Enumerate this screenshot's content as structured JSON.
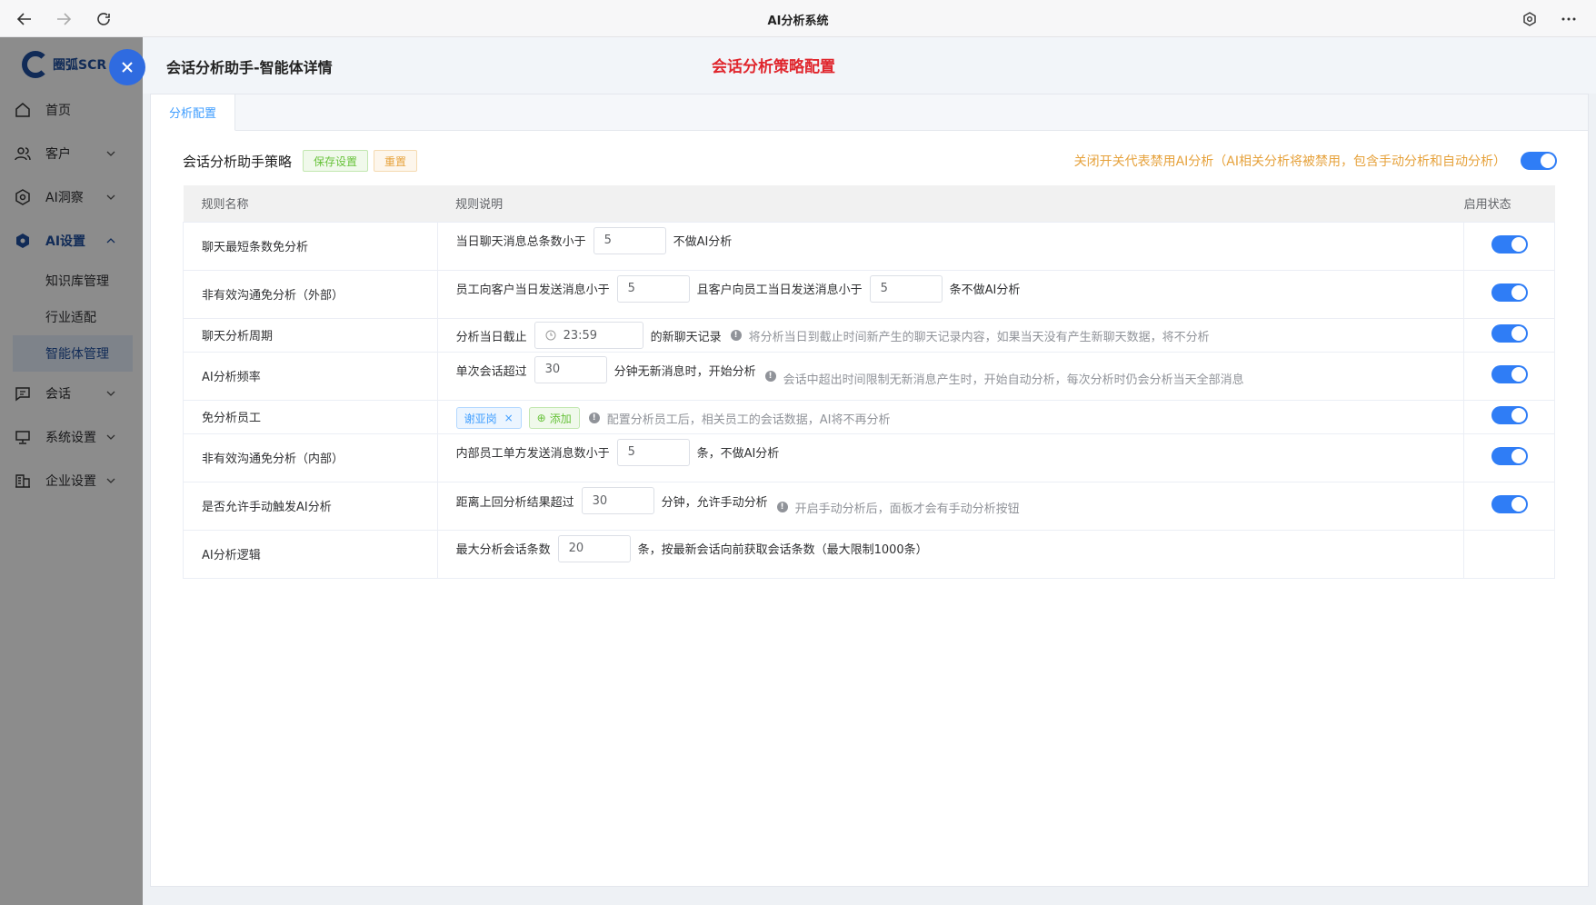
{
  "browser": {
    "title": "AI分析系统"
  },
  "sidebar": {
    "logo_text": "圈弧SCR",
    "items": [
      {
        "label": "首页"
      },
      {
        "label": "客户"
      },
      {
        "label": "AI洞察"
      },
      {
        "label": "AI设置"
      },
      {
        "label": "会话"
      },
      {
        "label": "系统设置"
      },
      {
        "label": "企业设置"
      }
    ],
    "sub_items": [
      {
        "label": "知识库管理"
      },
      {
        "label": "行业适配"
      },
      {
        "label": "智能体管理"
      }
    ]
  },
  "drawer": {
    "title": "会话分析助手-智能体详情",
    "annotation": "会话分析策略配置",
    "tab": "分析配置",
    "strategy_title": "会话分析助手策略",
    "save_label": "保存设置",
    "reset_label": "重置",
    "master_hint": "关闭开关代表禁用AI分析（AI相关分析将被禁用，包含手动分析和自动分析）",
    "master_enabled": true
  },
  "table": {
    "headers": {
      "name": "规则名称",
      "desc": "规则说明",
      "state": "启用状态"
    },
    "rows": [
      {
        "name": "聊天最短条数免分析",
        "t1": "当日聊天消息总条数小于",
        "v1": "5",
        "t2": "不做AI分析",
        "enabled": true
      },
      {
        "name": "非有效沟通免分析（外部）",
        "t1": "员工向客户当日发送消息小于",
        "v1": "5",
        "t2": "且客户向员工当日发送消息小于",
        "v2": "5",
        "t3": "条不做AI分析",
        "enabled": true
      },
      {
        "name": "聊天分析周期",
        "t1": "分析当日截止",
        "v1": "23:59",
        "t2": "的新聊天记录",
        "hint": "将分析当日到截止时间新产生的聊天记录内容，如果当天没有产生新聊天数据，将不分析",
        "enabled": true
      },
      {
        "name": "AI分析频率",
        "t1": "单次会话超过",
        "v1": "30",
        "t2": "分钟无新消息时，开始分析",
        "hint": "会话中超出时间限制无新消息产生时，开始自动分析，每次分析时仍会分析当天全部消息",
        "enabled": true
      },
      {
        "name": "免分析员工",
        "tag": "谢亚岗",
        "add": "添加",
        "hint": "配置分析员工后，相关员工的会话数据，AI将不再分析",
        "enabled": true
      },
      {
        "name": "非有效沟通免分析（内部）",
        "t1": "内部员工单方发送消息数小于",
        "v1": "5",
        "t2": "条，不做AI分析",
        "enabled": true
      },
      {
        "name": "是否允许手动触发AI分析",
        "t1": "距离上回分析结果超过",
        "v1": "30",
        "t2": "分钟，允许手动分析",
        "hint": "开启手动分析后，面板才会有手动分析按钮",
        "enabled": true
      },
      {
        "name": "AI分析逻辑",
        "t1": "最大分析会话条数",
        "v1": "20",
        "t2": "条，按最新会话向前获取会话条数（最大限制1000条）"
      }
    ]
  }
}
